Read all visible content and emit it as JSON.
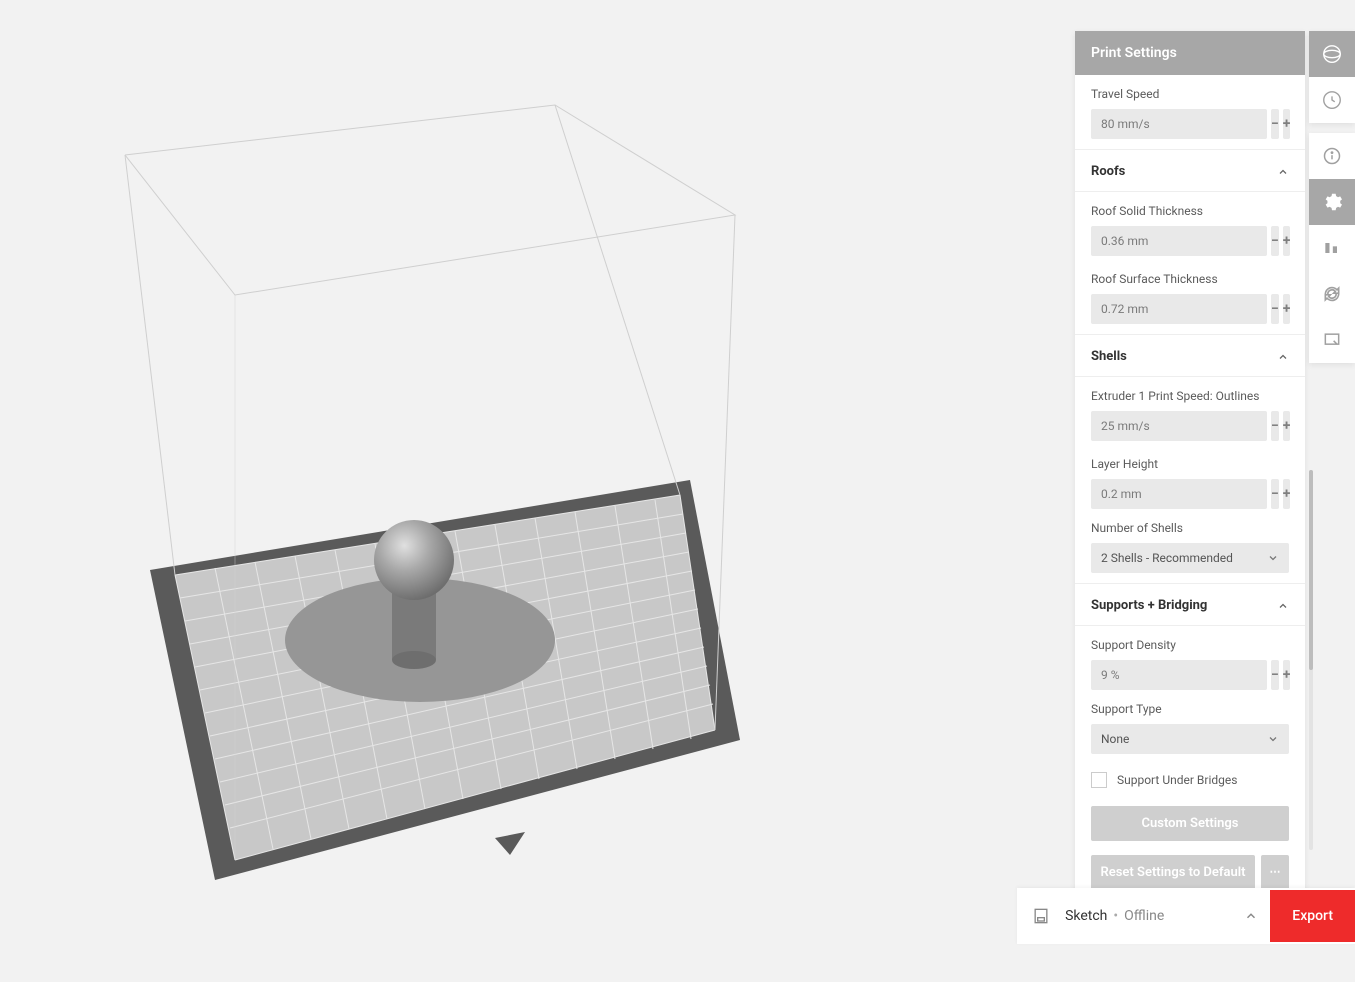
{
  "panel": {
    "title": "Print Settings",
    "travel_speed": {
      "label": "Travel Speed",
      "value": "80 mm/s"
    },
    "sections": {
      "roofs": {
        "title": "Roofs",
        "fields": {
          "solid": {
            "label": "Roof Solid Thickness",
            "value": "0.36 mm"
          },
          "surface": {
            "label": "Roof Surface Thickness",
            "value": "0.72 mm"
          }
        }
      },
      "shells": {
        "title": "Shells",
        "fields": {
          "outline_speed": {
            "label": "Extruder 1 Print Speed: Outlines",
            "value": "25 mm/s"
          },
          "layer_height": {
            "label": "Layer Height",
            "value": "0.2 mm"
          },
          "num_shells": {
            "label": "Number of Shells",
            "selected": "2 Shells - Recommended"
          }
        }
      },
      "supports": {
        "title": "Supports + Bridging",
        "fields": {
          "density": {
            "label": "Support Density",
            "value": "9 %"
          },
          "type": {
            "label": "Support Type",
            "selected": "None"
          },
          "under_bridges": {
            "label": "Support Under Bridges",
            "checked": false
          }
        }
      }
    },
    "custom_settings": "Custom Settings",
    "reset_default": "Reset Settings to Default"
  },
  "footer": {
    "device": "Sketch",
    "status": "Offline",
    "export": "Export"
  }
}
